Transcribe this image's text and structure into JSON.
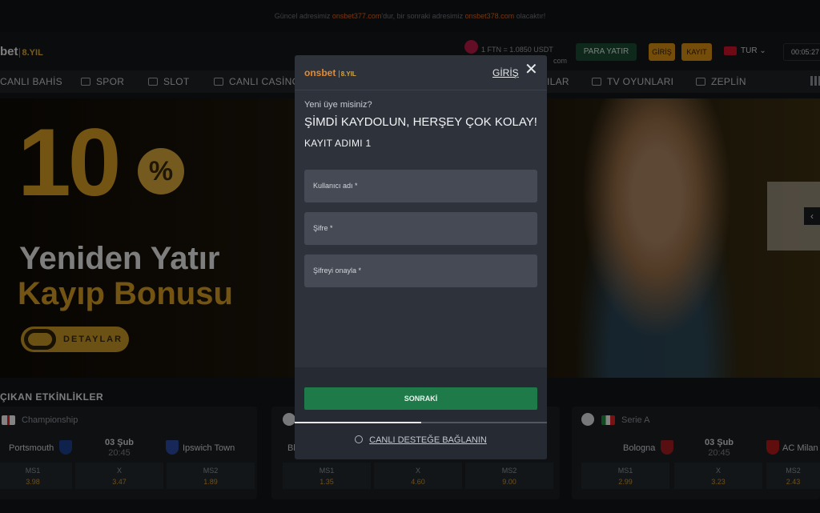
{
  "notice": {
    "prefix": "Güncel adresimiz ",
    "current": "onsbet377.com",
    "middle": "'dur, bir sonraki adresimiz ",
    "next": "onsbet378.com",
    "suffix": " olacaktır!"
  },
  "header": {
    "logo": "bet",
    "logo_suffix": "8.YIL",
    "rate_line1": "1 FTN = 1.0850 USDT",
    "rate_line2": "com",
    "deposit_label": "PARA YATIR",
    "login_label": "GİRİŞ",
    "register_label": "KAYIT",
    "language": "TUR",
    "clock": "00:05:27"
  },
  "nav": {
    "items": [
      "CANLI BAHİS",
      "SPOR",
      "SLOT",
      "CANLI CASİNO",
      "ILAR",
      "TV OYUNLARI",
      "ZEPLİN"
    ]
  },
  "banner": {
    "ten": "10",
    "percent": "%",
    "line1": "Yeniden Yatır",
    "line2": "Kayıp Bonusu",
    "cta": "DETAYLAR"
  },
  "events": {
    "title": "ÇIKAN ETKİNLİKLER",
    "matches": [
      {
        "league": "Championship",
        "home": "Portsmouth",
        "away": "Ipswich Town",
        "date": "03 Şub",
        "time": "20:45",
        "odds": [
          {
            "label": "MS1",
            "value": "3.98"
          },
          {
            "label": "X",
            "value": "3.47"
          },
          {
            "label": "MS2",
            "value": "1.89"
          }
        ]
      },
      {
        "league": "",
        "home": "Bl",
        "away": "",
        "date": "",
        "time": "",
        "odds": [
          {
            "label": "MS1",
            "value": "1.35"
          },
          {
            "label": "X",
            "value": "4.60"
          },
          {
            "label": "MS2",
            "value": "9.00"
          }
        ]
      },
      {
        "league": "Serie A",
        "home": "Bologna",
        "away": "AC Milan",
        "date": "03 Şub",
        "time": "20:45",
        "odds": [
          {
            "label": "MS1",
            "value": "2.99"
          },
          {
            "label": "X",
            "value": "3.23"
          },
          {
            "label": "MS2",
            "value": "2.43"
          }
        ]
      }
    ]
  },
  "modal": {
    "logo": "onsbet",
    "logo_yil": "8.YIL",
    "login_link": "GİRİŞ",
    "close": "✕",
    "question": "Yeni üye misiniz?",
    "title": "ŞİMDİ KAYDOLUN, HERŞEY ÇOK KOLAY!",
    "step": "KAYIT ADIMI 1",
    "fields": {
      "username": "Kullanıcı adı *",
      "password": "Şifre *",
      "confirm": "Şifreyi onayla *"
    },
    "next": "SONRAKİ",
    "progress": 0.5,
    "support": "CANLI DESTEĞE BAĞLANIN"
  },
  "colors": {
    "accent": "#d48c14",
    "success": "#1f7a4a",
    "modal_bg": "#2e323b"
  }
}
